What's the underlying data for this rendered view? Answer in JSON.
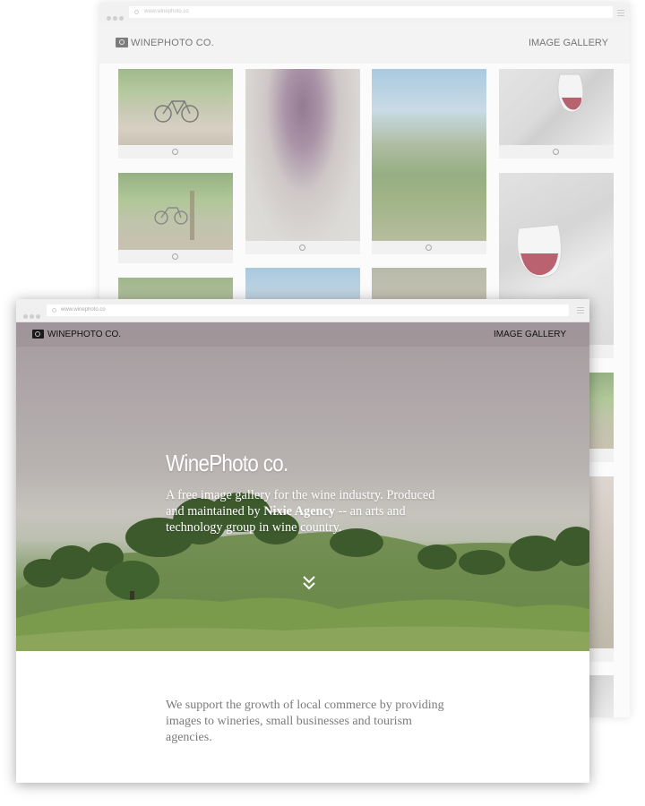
{
  "back_window": {
    "url": "www.winephoto.co",
    "brand": "WINEPHOTO CO.",
    "nav_link": "IMAGE GALLERY"
  },
  "front_window": {
    "url": "www.winephoto.co",
    "brand": "WINEPHOTO CO.",
    "nav_link": "IMAGE GALLERY",
    "hero": {
      "title": "WinePhoto co.",
      "description_before": "A free image gallery for the wine industry. Produced and maintained by ",
      "agency": "Nixie Agency",
      "description_after": " -- an arts and technology group in wine country."
    },
    "body_text": "We support the growth of local commerce by providing images to wineries, small businesses and tourism agencies."
  },
  "icons": [
    "camera-logo-icon",
    "lock-icon",
    "hamburger-menu-icon",
    "chevron-down-double-icon",
    "download-icon"
  ]
}
